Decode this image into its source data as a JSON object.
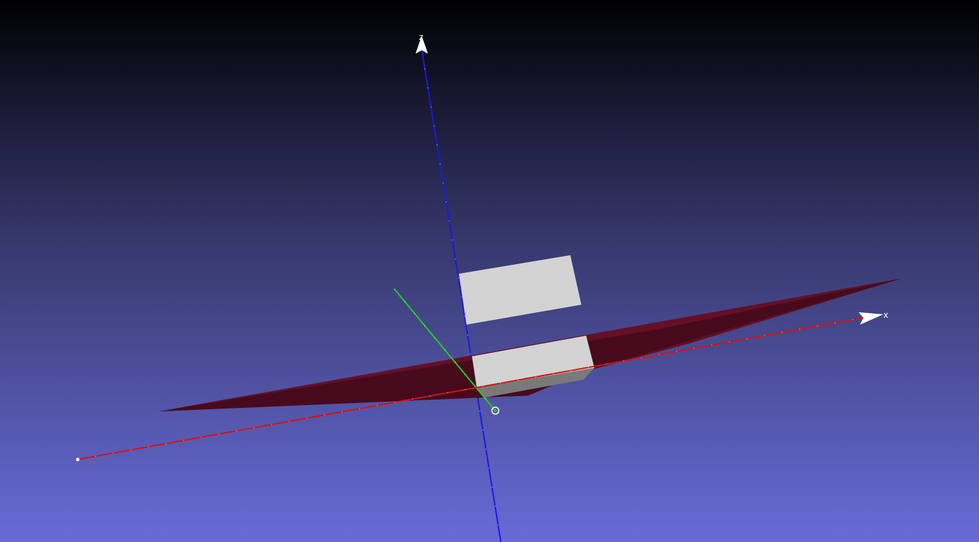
{
  "viewer": {
    "background": {
      "top_color": "#000000",
      "bottom_color": "#6a6ad8"
    },
    "axes": {
      "x": {
        "label": "x",
        "color": "#d01010"
      },
      "y": {
        "label": "",
        "color": "#10d010"
      },
      "z": {
        "label": "z",
        "color": "#1010e0"
      }
    },
    "plane": {
      "top_color": "#640f26",
      "under_color": "#470a1d"
    },
    "box": {
      "face_color": "#d3d3d3",
      "shade_color": "#7a7a7a"
    },
    "origin_marker": {
      "icon": "crosshair-icon"
    }
  }
}
